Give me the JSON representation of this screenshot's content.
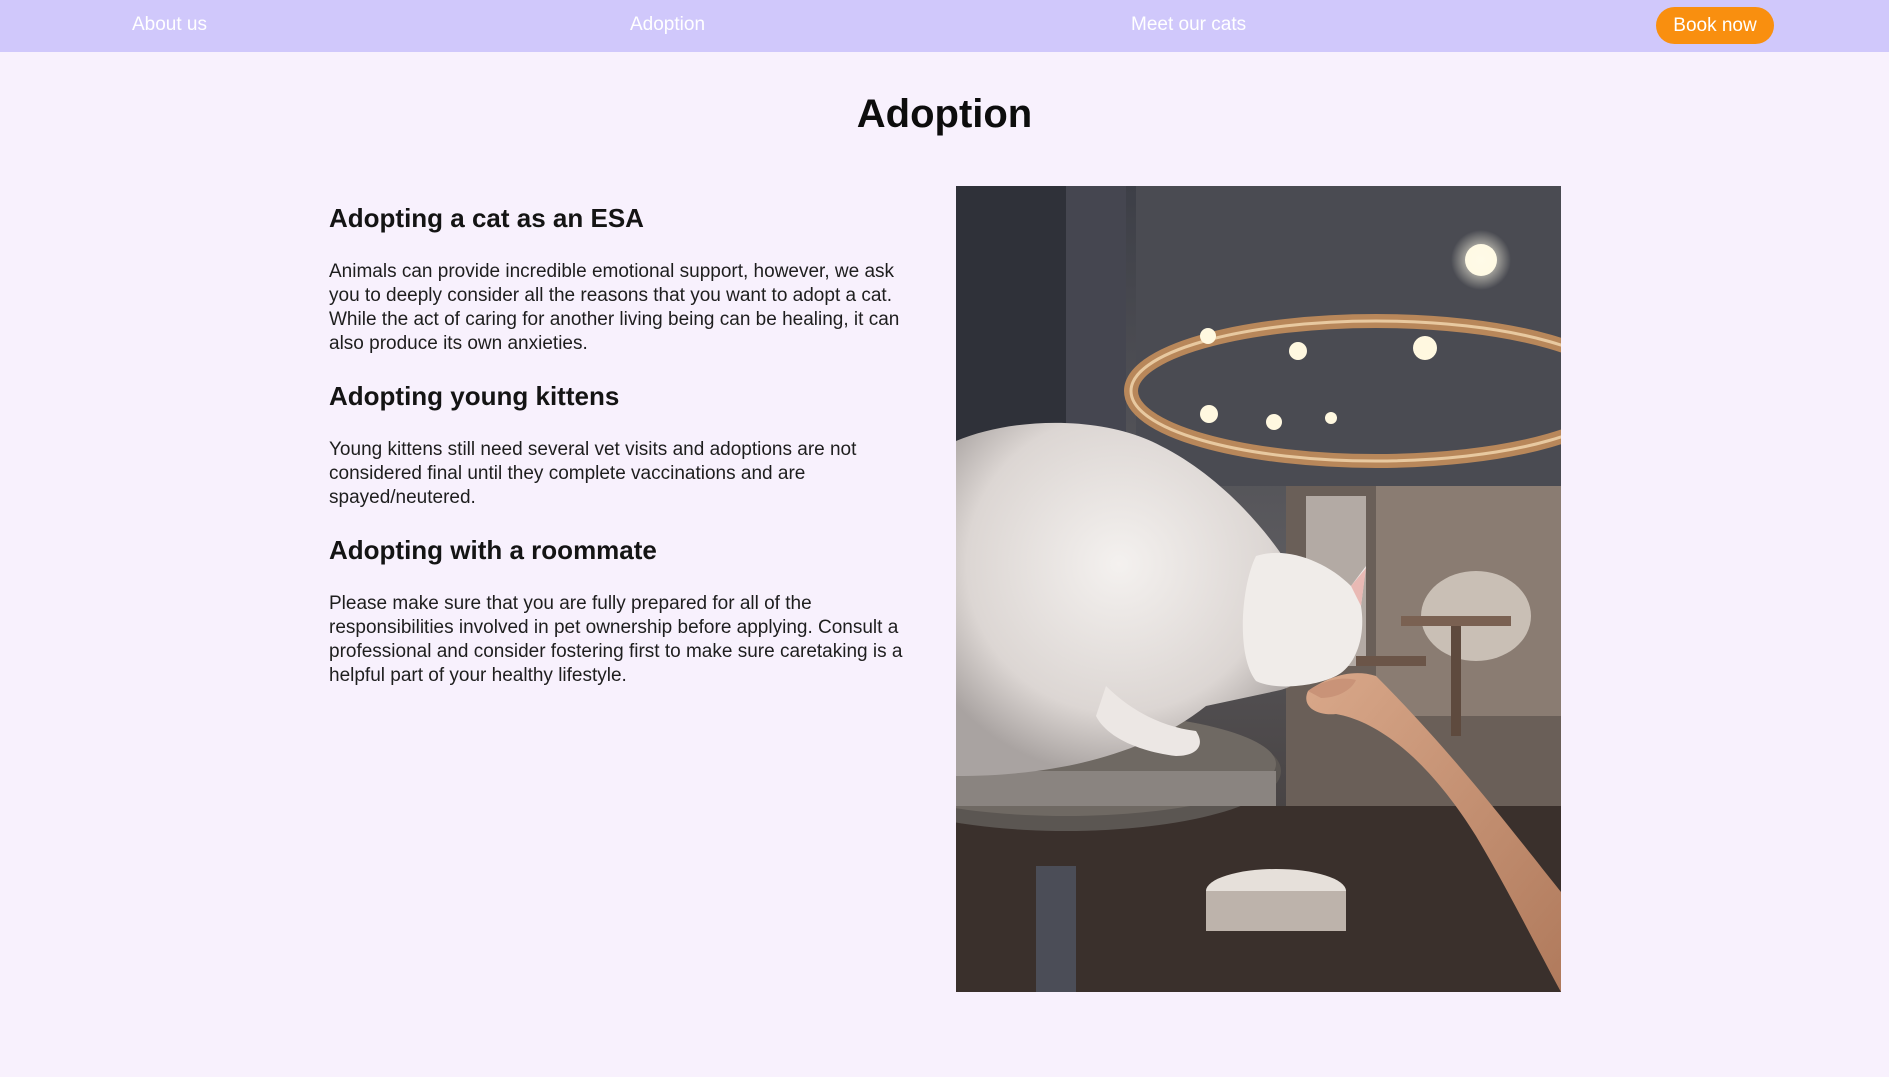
{
  "nav": {
    "about": "About us",
    "adoption": "Adoption",
    "cats": "Meet our cats",
    "book": "Book now"
  },
  "colors": {
    "nav_bg": "#d0c8fb",
    "page_bg": "#f8f1fd",
    "accent": "#f98f0f"
  },
  "page": {
    "title": "Adoption"
  },
  "sections": [
    {
      "heading": "Adopting a cat as an ESA",
      "body": "Animals can provide incredible emotional support, however, we ask you to deeply consider all the reasons that you want to adopt a cat. While the act of caring for another living being can be healing, it can also produce its own anxieties."
    },
    {
      "heading": "Adopting young kittens",
      "body": "Young kittens still need several vet visits and adoptions are not considered final until they complete vaccinations and are spayed/neutered."
    },
    {
      "heading": "Adopting with a roommate",
      "body": "Please make sure that you are fully prepared for all of the responsibilities involved in pet ownership before applying. Consult a professional and consider fostering first to make sure caretaking is a helpful part of your healthy lifestyle."
    }
  ],
  "image": {
    "subject": "white-fluffy-cat-photo"
  }
}
